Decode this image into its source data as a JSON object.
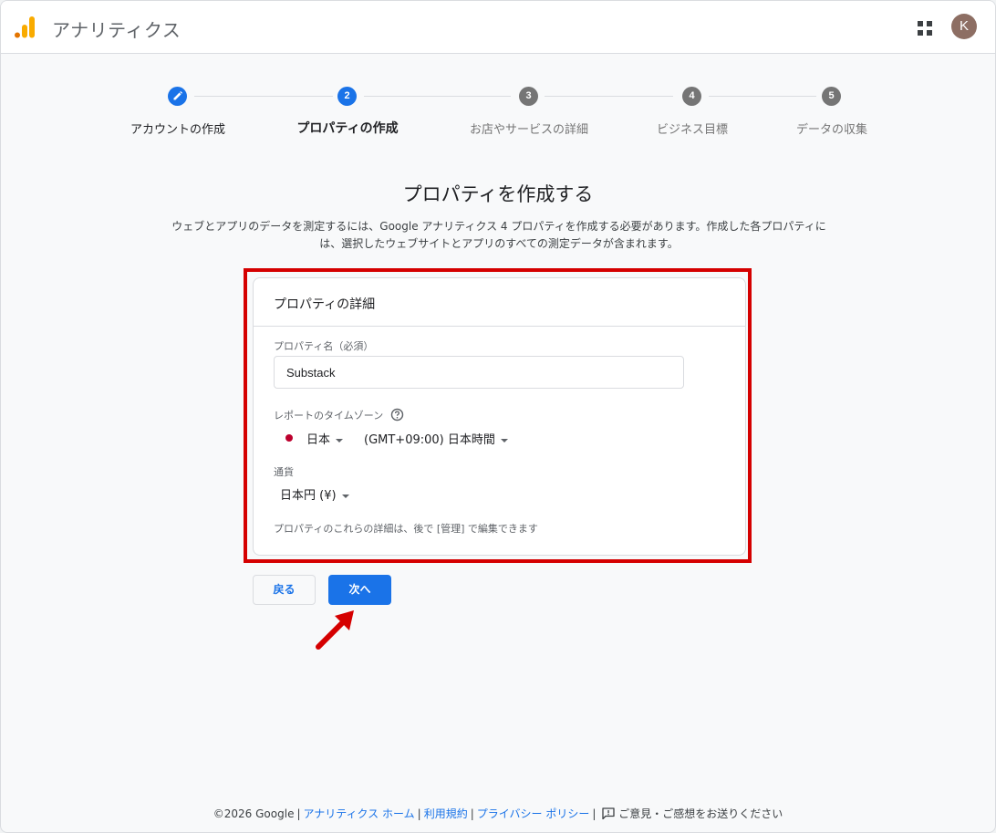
{
  "header": {
    "app_title": "アナリティクス",
    "logo_icon": "google-analytics-logo",
    "apps_icon": "apps-grid-icon",
    "avatar_letter": "K",
    "avatar_color": "#8d6e63"
  },
  "stepper": {
    "steps": [
      {
        "number": "",
        "label": "アカウントの作成",
        "state": "completed",
        "icon": "edit-pencil-icon"
      },
      {
        "number": "2",
        "label": "プロパティの作成",
        "state": "active"
      },
      {
        "number": "3",
        "label": "お店やサービスの詳細",
        "state": "upcoming"
      },
      {
        "number": "4",
        "label": "ビジネス目標",
        "state": "upcoming"
      },
      {
        "number": "5",
        "label": "データの収集",
        "state": "upcoming"
      }
    ]
  },
  "main": {
    "title": "プロパティを作成する",
    "description": "ウェブとアプリのデータを測定するには、Google アナリティクス 4 プロパティを作成する必要があります。作成した各プロパティには、選択したウェブサイトとアプリのすべての測定データが含まれます。"
  },
  "card": {
    "title": "プロパティの詳細",
    "property_name_label": "プロパティ名（必須）",
    "property_name_value": "Substack",
    "timezone_label": "レポートのタイムゾーン",
    "country_value": "日本",
    "timezone_value": "(GMT+09:00) 日本時間",
    "currency_label": "通貨",
    "currency_value": "日本円 (¥)",
    "note": "プロパティのこれらの詳細は、後で [管理] で編集できます"
  },
  "buttons": {
    "back_label": "戻る",
    "next_label": "次へ"
  },
  "footer": {
    "copyright": "©2026 Google",
    "links": [
      "アナリティクス ホーム",
      "利用規約",
      "プライバシー ポリシー"
    ],
    "feedback": "ご意見・ご感想をお送りください"
  },
  "colors": {
    "accent": "#1a73e8",
    "highlight": "#d50000",
    "step_upcoming": "#757575"
  }
}
